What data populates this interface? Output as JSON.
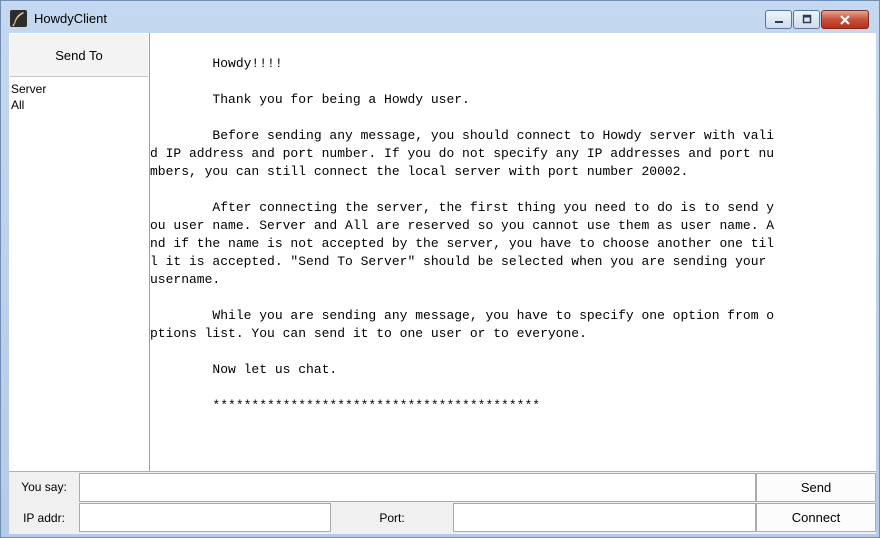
{
  "window": {
    "title": "HowdyClient"
  },
  "sidebar": {
    "send_to_label": "Send To",
    "recipients": [
      "Server",
      "All"
    ]
  },
  "message_area": {
    "text": "        Howdy!!!!\n\n        Thank you for being a Howdy user.\n\n        Before sending any message, you should connect to Howdy server with vali\nd IP address and port number. If you do not specify any IP addresses and port nu\nmbers, you can still connect the local server with port number 20002.\n\n        After connecting the server, the first thing you need to do is to send y\nou user name. Server and All are reserved so you cannot use them as user name. A\nnd if the name is not accepted by the server, you have to choose another one til\nl it is accepted. \"Send To Server\" should be selected when you are sending your\nusername.\n\n        While you are sending any message, you have to specify one option from o\nptions list. You can send it to one user or to everyone.\n\n        Now let us chat.\n\n        ******************************************"
  },
  "bottom_bar": {
    "you_say_label": "You say:",
    "you_say_value": "",
    "send_label": "Send",
    "ip_label": "IP addr:",
    "ip_value": "",
    "port_label": "Port:",
    "port_value": "",
    "connect_label": "Connect"
  },
  "icons": {
    "app": "quill-icon",
    "minimize": "minimize-icon",
    "maximize": "maximize-icon",
    "close": "close-icon"
  }
}
